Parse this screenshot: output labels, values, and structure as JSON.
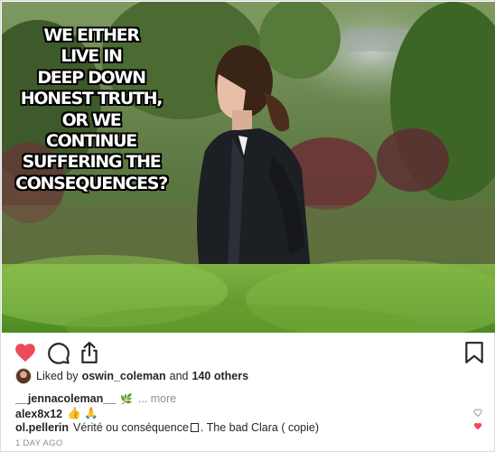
{
  "post": {
    "meme_lines": [
      "WE EITHER",
      "LIVE IN",
      "DEEP DOWN",
      "HONEST TRUTH,",
      "OR WE",
      "CONTINUE",
      "SUFFERING THE",
      "CONSEQUENCES?"
    ],
    "liked_heart_color": "#ed4956"
  },
  "likes": {
    "prefix": "Liked by",
    "user": "oswin_coleman",
    "joiner": "and",
    "count_text": "140 others"
  },
  "caption": {
    "user": "__jennacoleman__",
    "leaf_icon": "leaf-icon",
    "more": "... more"
  },
  "comments": [
    {
      "user": "alex8x12",
      "text": "👍 🙏",
      "liked": false
    },
    {
      "user": "ol.pellerin",
      "text_before": "Vérité ou conséquence",
      "text_after": ". The bad Clara ( copie)",
      "liked": true
    }
  ],
  "timestamp": "1 DAY AGO"
}
